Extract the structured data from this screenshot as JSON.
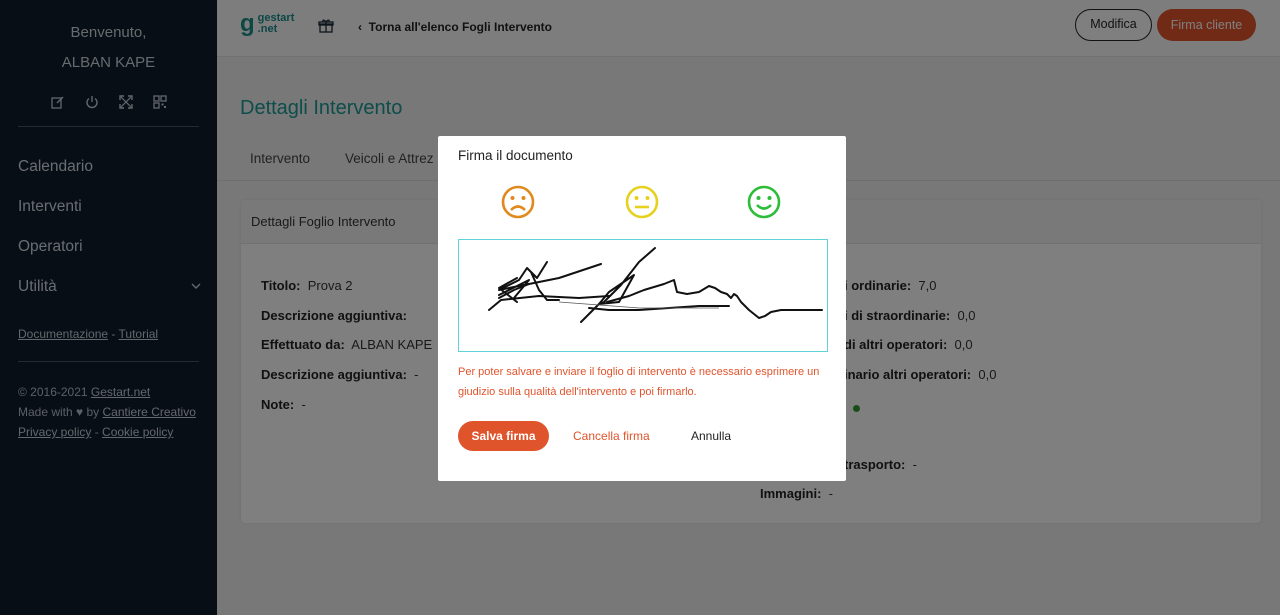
{
  "sidebar": {
    "welcome_line1": "Benvenuto,",
    "welcome_line2": "ALBAN KAPE",
    "icons": [
      "edit-icon",
      "power-icon",
      "expand-icon",
      "qrcode-icon"
    ],
    "nav": [
      "Calendario",
      "Interventi",
      "Operatori",
      "Utilità"
    ],
    "links": {
      "docs": "Documentazione",
      "separator": " - ",
      "tutorial": "Tutorial"
    },
    "footer": {
      "copyright_prefix": "© 2016-2021 ",
      "copyright_link": "Gestart.net",
      "made_with_prefix": "Made with ♥ by ",
      "made_with_link": "Cantiere Creativo",
      "privacy": "Privacy policy",
      "separator": " - ",
      "cookie": "Cookie policy"
    }
  },
  "topbar": {
    "logo_text_1": "gestart",
    "logo_text_2": ".net",
    "back_label": "Torna all'elenco Fogli Intervento",
    "modifica_label": "Modifica",
    "firma_cliente_label": "Firma cliente"
  },
  "main": {
    "title": "Dettagli Intervento",
    "tabs": [
      "Intervento",
      "Veicoli e Attrez"
    ],
    "card_title": "Dettagli Foglio Intervento",
    "left_fields": [
      {
        "label": "Titolo:",
        "value": "Prova 2"
      },
      {
        "label": "Descrizione aggiuntiva:",
        "value": ""
      },
      {
        "label": "Effettuato da:",
        "value": "ALBAN KAPE"
      },
      {
        "label": "Descrizione aggiuntiva:",
        "value": "-"
      },
      {
        "label": "Note:",
        "value": "-"
      }
    ],
    "right_fields": [
      {
        "label": "i ordinarie:",
        "value": "7,0"
      },
      {
        "label": "i di straordinarie:",
        "value": "0,0"
      },
      {
        "label": "di altri operatori:",
        "value": "0,0"
      },
      {
        "label": "inario altri operatori:",
        "value": "0,0"
      },
      {
        "label": "trasporto:",
        "value": "-"
      },
      {
        "label": "Immagini:",
        "value": "-"
      }
    ],
    "status_color": "#2e9a2e"
  },
  "modal": {
    "title": "Firma il documento",
    "smileys": [
      {
        "icon": "sad-face-icon",
        "color": "#e08a1e"
      },
      {
        "icon": "neutral-face-icon",
        "color": "#e6d21e"
      },
      {
        "icon": "happy-face-icon",
        "color": "#2ebd3a"
      }
    ],
    "message": "Per poter salvare e inviare il foglio di intervento è necessario esprimere un giudizio sulla qualità dell'intervento e poi firmarlo.",
    "save_label": "Salva firma",
    "clear_label": "Cancella firma",
    "cancel_label": "Annulla"
  },
  "colors": {
    "accent": "#e0542c",
    "teal": "#1a9a96",
    "sidebar_bg": "#0e1c2b",
    "signature_border": "#5fd3d9"
  }
}
